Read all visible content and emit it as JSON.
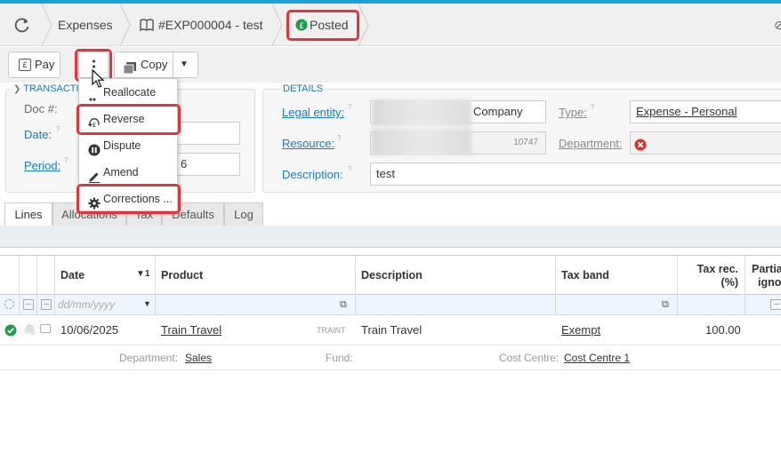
{
  "header": {
    "nav_expenses": "Expenses",
    "doc_ref": "#EXP000004 - test",
    "status": "Posted"
  },
  "toolbar": {
    "pay_label": "Pay",
    "copy_label": "Copy"
  },
  "menu": {
    "items": [
      {
        "label": "Reallocate",
        "icon": "reallocate-icon"
      },
      {
        "label": "Reverse",
        "icon": "reverse-pound-icon"
      },
      {
        "label": "Dispute",
        "icon": "pause-circle-icon"
      },
      {
        "label": "Amend",
        "icon": "pen-icon"
      },
      {
        "label": "Corrections ...",
        "icon": "gear-icon"
      }
    ]
  },
  "transaction": {
    "legend": "TRANSACTIO",
    "doc_label": "Doc #:",
    "date_label": "Date:",
    "period_label": "Period:",
    "period_value_tail": "6"
  },
  "details": {
    "legend": "DETAILS",
    "legal_entity_label": "Legal entity:",
    "legal_entity_value": "Company",
    "type_label": "Type:",
    "type_value": "Expense - Personal",
    "resource_label": "Resource:",
    "resource_code": "10747",
    "department_label": "Department:",
    "description_label": "Description:",
    "description_value": "test"
  },
  "tabs": [
    "Lines",
    "Allocations",
    "Tax",
    "Defaults",
    "Log"
  ],
  "grid": {
    "columns": {
      "date": "Date",
      "date_sort": "▼1",
      "product": "Product",
      "description": "Description",
      "tax_band": "Tax band",
      "tax_rec_1": "Tax rec.",
      "tax_rec_2": "(%)",
      "partial_1": "Partia",
      "partial_2": "igno"
    },
    "filter_date_placeholder": "dd/mm/yyyy",
    "row": {
      "date": "10/06/2025",
      "product": "Train Travel",
      "product_code": "TRAINT",
      "description": "Train Travel",
      "tax_band": "Exempt",
      "tax_rec": "100.00"
    },
    "sub": {
      "department_label": "Department:",
      "department_value": "Sales",
      "fund_label": "Fund:",
      "cost_centre_label": "Cost Centre:",
      "cost_centre_value": "Cost Centre 1"
    }
  },
  "colors": {
    "accent": "#1aa1d9",
    "link": "#1a7bbf",
    "highlight": "#e0353b",
    "posted_green": "#1f9d4a",
    "error_red": "#d9302c"
  }
}
